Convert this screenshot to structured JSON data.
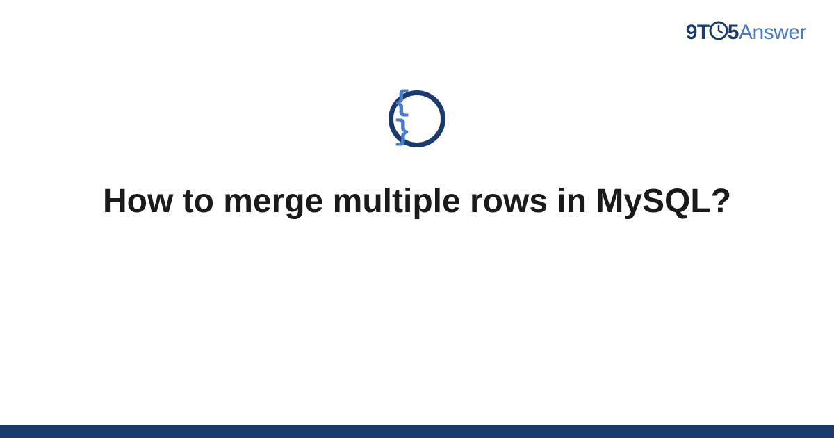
{
  "brand": {
    "part1": "9T",
    "part2": "5",
    "part3": "Answer"
  },
  "category": {
    "icon_name": "code-braces",
    "symbol": "{ }"
  },
  "question": {
    "title": "How to merge multiple rows in MySQL?"
  },
  "colors": {
    "dark_blue": "#1a3a6e",
    "light_blue": "#4a7bc8"
  }
}
